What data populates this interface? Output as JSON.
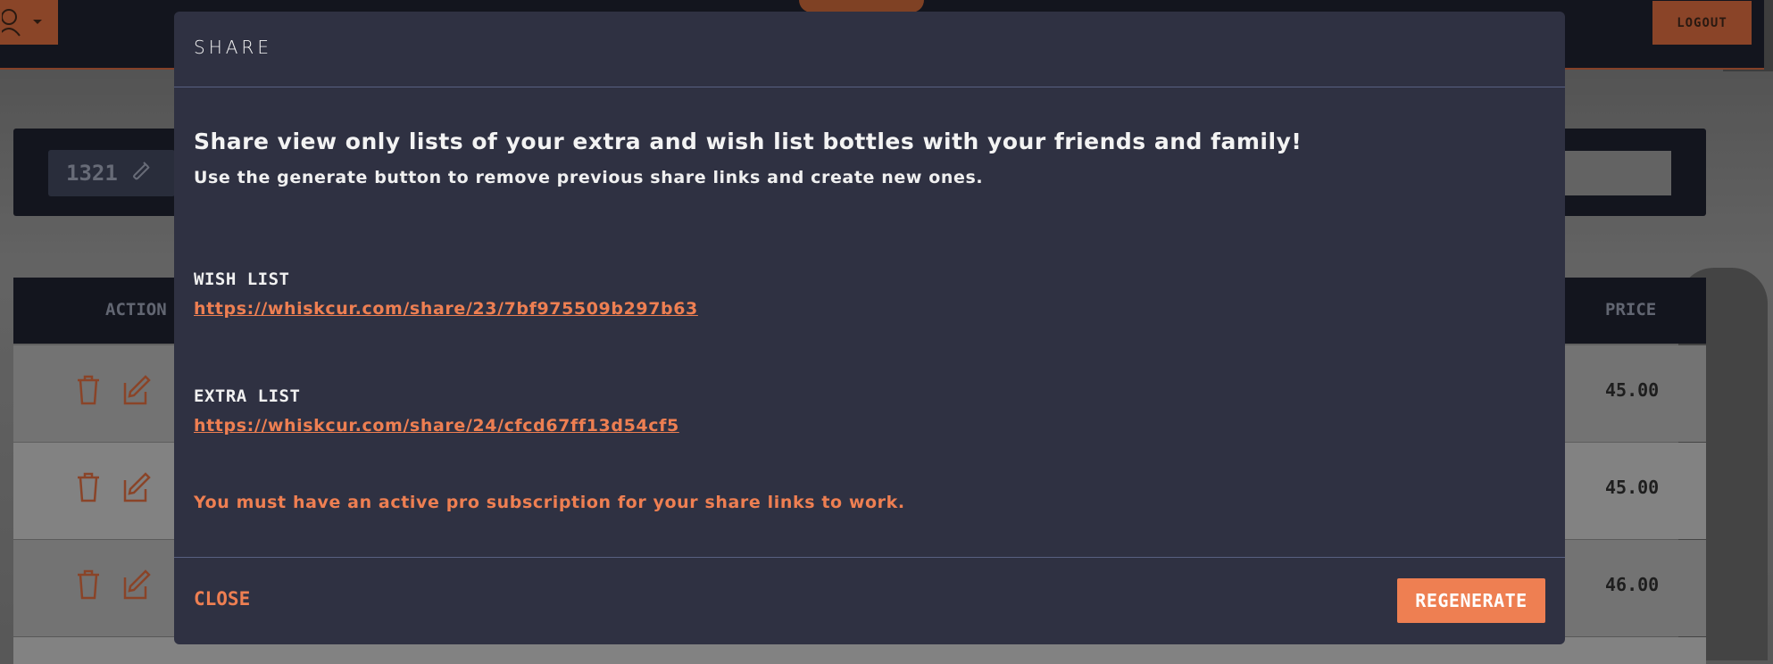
{
  "header": {
    "logout_label": "LOGOUT"
  },
  "toolbar": {
    "bottle_count": "1321"
  },
  "table": {
    "actions_header": "ACTION",
    "price_header": "PRICE",
    "rows": [
      {
        "price": "45.00"
      },
      {
        "price": "45.00"
      },
      {
        "price": "46.00"
      }
    ]
  },
  "modal": {
    "title": "SHARE",
    "intro": "Share view only lists of your extra and wish list bottles with your friends and family!",
    "subintro": "Use the generate button to remove previous share links and create new ones.",
    "wish_label": "WISH LIST",
    "wish_link": "https://whiskcur.com/share/23/7bf975509b297b63",
    "extra_label": "EXTRA LIST",
    "extra_link": "https://whiskcur.com/share/24/cfcd67ff13d54cf5",
    "warning": "You must have an active pro subscription for your share links to work.",
    "close_label": "CLOSE",
    "regenerate_label": "REGENERATE"
  },
  "colors": {
    "accent": "#ee7f52",
    "modal_bg": "#2f3142",
    "dark_bar": "#1b1e2a"
  }
}
